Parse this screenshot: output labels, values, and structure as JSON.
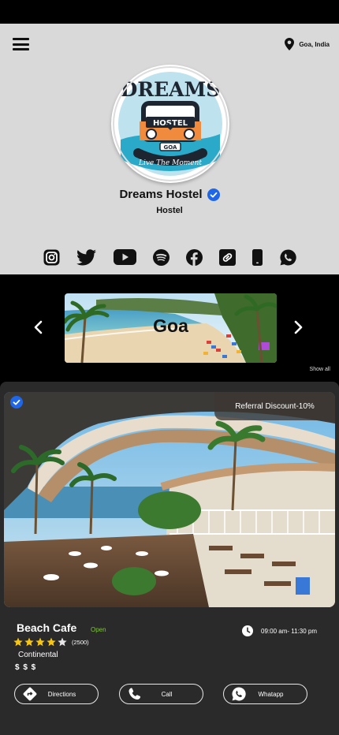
{
  "location": {
    "text": "Goa, India"
  },
  "profile": {
    "logo_top_text": "DREAMS",
    "logo_badge_text": "HOSTEL",
    "logo_plate_text": "GOA",
    "logo_tagline": "Live The Moment",
    "name": "Dreams Hostel",
    "category": "Hostel"
  },
  "socials": [
    "instagram-icon",
    "twitter-icon",
    "youtube-icon",
    "spotify-icon",
    "facebook-icon",
    "link-icon",
    "phone-icon",
    "whatsapp-icon"
  ],
  "carousel": {
    "banner_title": "Goa",
    "show_all": "Show all"
  },
  "card": {
    "referral": "Referral Discount-10%",
    "name": "Beach Cafe",
    "status": "Open",
    "rating": 4,
    "rating_max": 5,
    "rating_count": "(2500)",
    "cuisine": "Continental",
    "price": "$ $ $",
    "hours": "09:00 am- 11:30 pm",
    "buttons": {
      "directions": "Directions",
      "call": "Call",
      "whatsapp": "Whatapp"
    }
  },
  "colors": {
    "accent_blue": "#1f67e8",
    "status_green": "#7ec63a",
    "star_yellow": "#f5c518",
    "panel_gray": "#d9d9d9",
    "card_dark": "#2a2a2a"
  }
}
